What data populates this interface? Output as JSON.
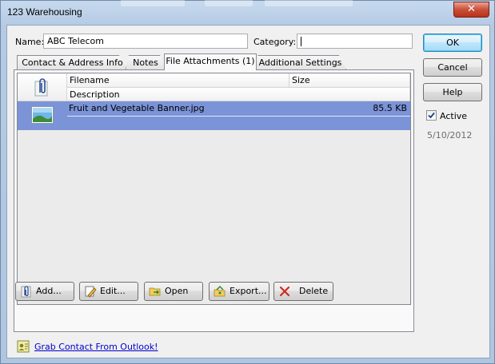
{
  "window": {
    "title": "123 Warehousing",
    "close_symbol": "✕"
  },
  "form": {
    "name_label": "Name:",
    "name_value": "ABC Telecom",
    "category_label": "Category:",
    "category_value": ""
  },
  "tabs": [
    {
      "label": "Contact & Address Info",
      "active": false
    },
    {
      "label": "Notes",
      "active": false
    },
    {
      "label": "File Attachments (1)",
      "active": true
    },
    {
      "label": "Additional Settings",
      "active": false
    }
  ],
  "grid": {
    "columns": {
      "filename": "Filename",
      "size": "Size",
      "description": "Description"
    },
    "rows": [
      {
        "filename": "Fruit and Vegetable Banner.jpg",
        "size": "85.5 KB",
        "description": "",
        "icon": "image-icon",
        "selected": true
      }
    ]
  },
  "actions": {
    "add": "Add...",
    "edit": "Edit...",
    "open": "Open",
    "export": "Export...",
    "delete": "Delete"
  },
  "side": {
    "ok": "OK",
    "cancel": "Cancel",
    "help": "Help",
    "active_label": "Active",
    "active_checked": true,
    "date": "5/10/2012"
  },
  "footer": {
    "grab_link": "Grab Contact From Outlook!"
  },
  "colors": {
    "selection": "#7b93d7",
    "link": "#0000cc",
    "close": "#c94f38",
    "chrome": "#b5cbe4"
  }
}
